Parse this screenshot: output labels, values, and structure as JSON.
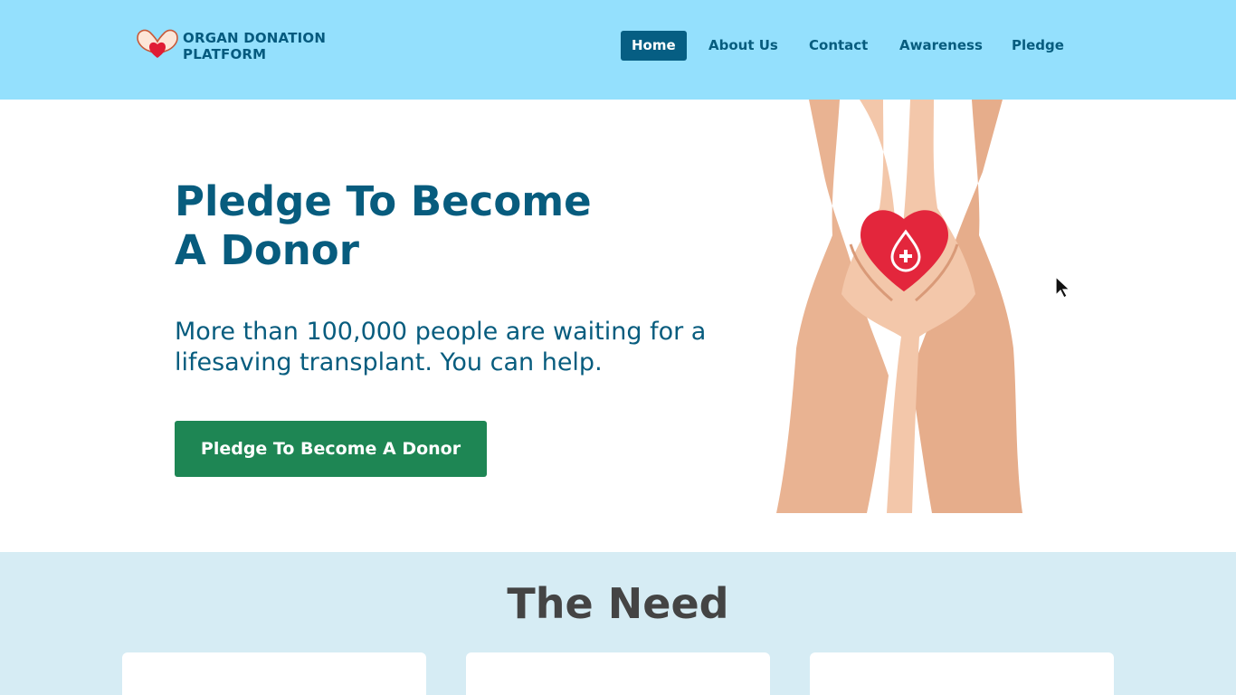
{
  "logo": {
    "line1": "ORGAN DONATION",
    "line2": "PLATFORM",
    "icon": "hands-heart-icon"
  },
  "nav": {
    "items": [
      {
        "label": "Home",
        "active": true
      },
      {
        "label": "About Us"
      },
      {
        "label": "Contact"
      },
      {
        "label": "Awareness"
      },
      {
        "label": "Pledge"
      }
    ]
  },
  "hero": {
    "title_line1": "Pledge To Become",
    "title_line2": "A Donor",
    "subtitle": "More than 100,000 people are waiting for a lifesaving transplant. You can help.",
    "cta_label": "Pledge To Become A Donor",
    "image_icon": "hands-holding-heart-icon"
  },
  "need": {
    "title": "The Need"
  },
  "colors": {
    "header_bg": "#94e0fd",
    "primary": "#075c7e",
    "cta": "#1e8654",
    "section_bg": "#d6ecf4"
  }
}
